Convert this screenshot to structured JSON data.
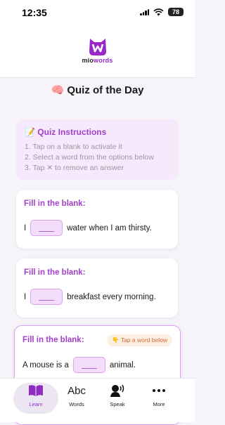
{
  "status": {
    "time": "12:35",
    "battery": "78"
  },
  "brand": {
    "prefix": "mio",
    "suffix": "words"
  },
  "page": {
    "title": "🧠 Quiz of the Day"
  },
  "instructions": {
    "title": "📝 Quiz Instructions",
    "steps": [
      "1. Tap on a blank to activate it",
      "2. Select a word from the options below",
      "3. Tap ✕ to remove an answer"
    ]
  },
  "questions": [
    {
      "label": "Fill in the blank:",
      "before": "I",
      "after": "water when I am thirsty."
    },
    {
      "label": "Fill in the blank:",
      "before": "I",
      "after": "breakfast every morning."
    },
    {
      "label": "Fill in the blank:",
      "before": "A mouse is a",
      "after": "animal.",
      "hint": "👇 Tap a word below"
    }
  ],
  "tabs": [
    {
      "label": "Learn",
      "icon": "book-icon"
    },
    {
      "label": "Words",
      "glyph": "Abc",
      "icon": "abc-icon"
    },
    {
      "label": "Speak",
      "icon": "speaking-head-icon"
    },
    {
      "label": "More",
      "icon": "ellipsis-icon"
    }
  ],
  "colors": {
    "accent": "#a23fc9",
    "blank_fill": "#f4dcfb",
    "instructions_bg": "#f5e9fb"
  }
}
